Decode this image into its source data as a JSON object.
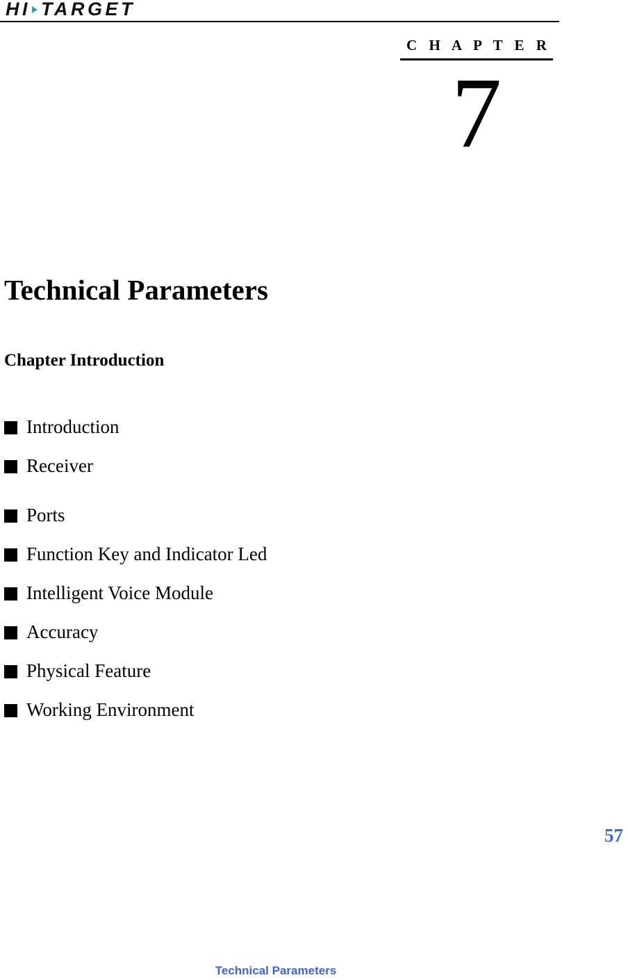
{
  "brand": {
    "logo_prefix": "HI",
    "logo_suffix": "TARGET",
    "logo_full": "HI·TARGET",
    "arrow_icon": "triangle-right-icon",
    "arrow_color": "#2b9ec4"
  },
  "chapter": {
    "label": "C H A P T E R",
    "number": "7"
  },
  "title": "Technical Parameters",
  "section_heading": "Chapter Introduction",
  "topics": [
    {
      "label": "Introduction"
    },
    {
      "label": "Receiver"
    },
    {
      "label": "Ports"
    },
    {
      "label": "Function Key and Indicator Led"
    },
    {
      "label": "Intelligent Voice Module"
    },
    {
      "label": "Accuracy"
    },
    {
      "label": "Physical Feature"
    },
    {
      "label": "Working Environment"
    }
  ],
  "page_number": "57",
  "footer": {
    "text": "Technical Parameters",
    "color": "#3a63e8"
  }
}
